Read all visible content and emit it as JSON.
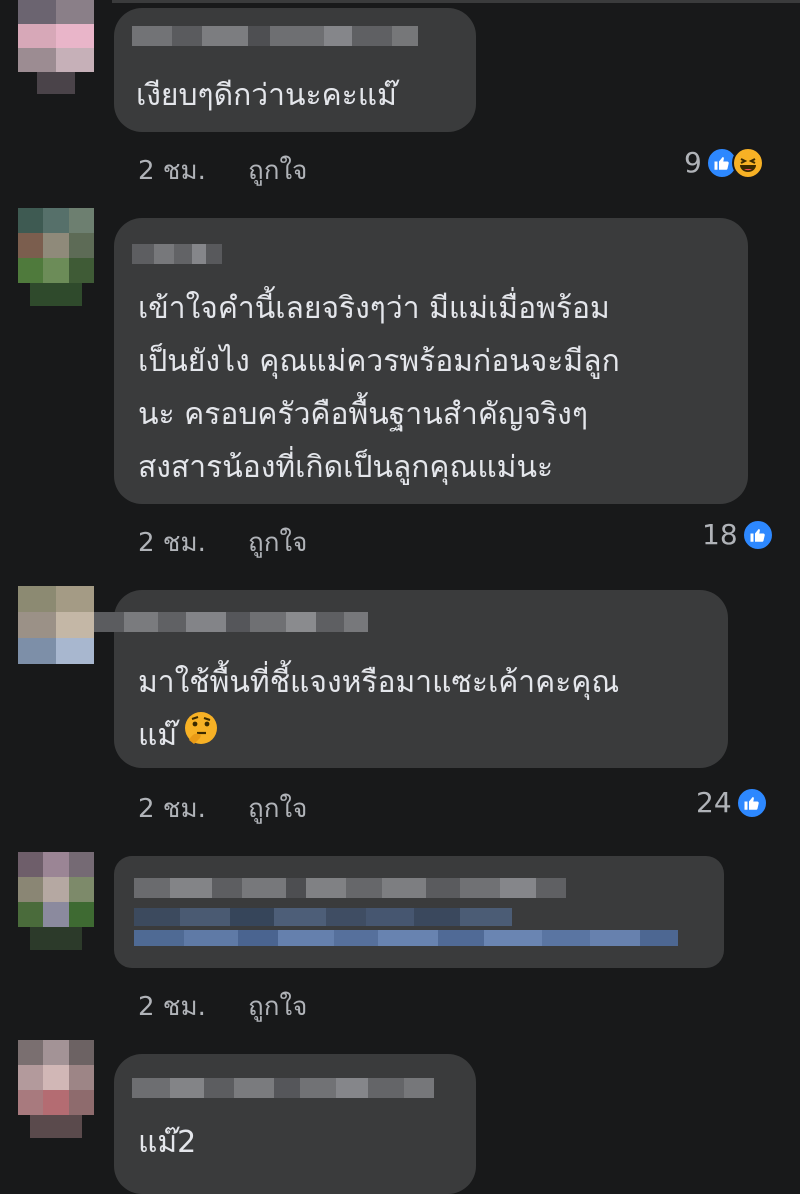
{
  "colors": {
    "background": "#18191a",
    "bubble": "#3a3b3c",
    "text": "#e4e6eb",
    "meta": "#b0b3b8",
    "like_blue": "#2d88ff",
    "haha_yellow": "#f7b125"
  },
  "comments": [
    {
      "author": "",
      "lines": [
        "เงียบๆดีกว่านะคะแม๊"
      ],
      "time": "2 ชม.",
      "like_label": "ถูกใจ",
      "reaction_count": "9",
      "reaction_icons": [
        "like-icon",
        "haha-icon"
      ]
    },
    {
      "author": "",
      "lines": [
        "เข้าใจคำนี้เลยจริงๆว่า มีแม่เมื่อพร้อม",
        "เป็นยังไง  คุณแม่ควรพร้อมก่อนจะมีลูก",
        "นะ ครอบครัวคือพื้นฐานสำคัญจริงๆ",
        "สงสารน้องที่เกิดเป็นลูกคุณแม่นะ"
      ],
      "time": "2 ชม.",
      "like_label": "ถูกใจ",
      "reaction_count": "18",
      "reaction_icons": [
        "like-icon"
      ]
    },
    {
      "author": "",
      "lines": [
        "มาใช้พื้นที่ชี้แจงหรือมาแซะเค้าคะคุณ",
        "แม๊"
      ],
      "emoji": "thinking-face-icon",
      "time": "2 ชม.",
      "like_label": "ถูกใจ",
      "reaction_count": "24",
      "reaction_icons": [
        "like-icon"
      ]
    },
    {
      "author": "",
      "lines": [],
      "time": "2 ชม.",
      "like_label": "ถูกใจ",
      "reaction_count": "",
      "reaction_icons": []
    },
    {
      "author": "",
      "lines": [
        "แม๊2"
      ],
      "time": "",
      "like_label": "",
      "reaction_count": "",
      "reaction_icons": []
    }
  ]
}
